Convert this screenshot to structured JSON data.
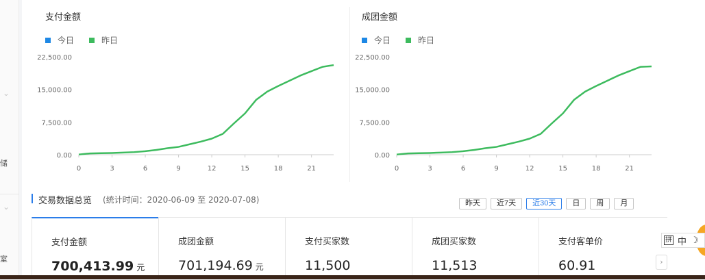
{
  "sidebar": {
    "chars": [
      "储",
      "室"
    ]
  },
  "charts": [
    {
      "title": "支付金额",
      "legend": [
        {
          "label": "今日",
          "color": "#1e88e5"
        },
        {
          "label": "昨日",
          "color": "#3dbb5e"
        }
      ],
      "y_ticks": [
        "22,500.00",
        "15,000.00",
        "7,500.00",
        "0.00"
      ],
      "x_ticks": [
        "0",
        "3",
        "6",
        "9",
        "12",
        "15",
        "18",
        "21"
      ]
    },
    {
      "title": "成团金额",
      "legend": [
        {
          "label": "今日",
          "color": "#1e88e5"
        },
        {
          "label": "昨日",
          "color": "#3dbb5e"
        }
      ],
      "y_ticks": [
        "22,500.00",
        "15,000.00",
        "7,500.00",
        "0.00"
      ],
      "x_ticks": [
        "0",
        "3",
        "6",
        "9",
        "12",
        "15",
        "18",
        "21"
      ]
    }
  ],
  "chart_data": [
    {
      "type": "line",
      "title": "支付金额",
      "x": [
        0,
        1,
        2,
        3,
        4,
        5,
        6,
        7,
        8,
        9,
        10,
        11,
        12,
        13,
        14,
        15,
        16,
        17,
        18,
        19,
        20,
        21,
        22,
        23
      ],
      "ylim": [
        0,
        22500
      ],
      "series": [
        {
          "name": "昨日",
          "color": "#3dbb5e",
          "values": [
            50,
            300,
            350,
            400,
            500,
            600,
            800,
            1100,
            1500,
            1800,
            2400,
            3000,
            3700,
            4800,
            7200,
            9500,
            12600,
            14500,
            15800,
            17000,
            18200,
            19200,
            20200,
            20600
          ]
        }
      ]
    },
    {
      "type": "line",
      "title": "成团金额",
      "x": [
        0,
        1,
        2,
        3,
        4,
        5,
        6,
        7,
        8,
        9,
        10,
        11,
        12,
        13,
        14,
        15,
        16,
        17,
        18,
        19,
        20,
        21,
        22,
        23
      ],
      "ylim": [
        0,
        22500
      ],
      "series": [
        {
          "name": "昨日",
          "color": "#3dbb5e",
          "values": [
            50,
            300,
            350,
            400,
            500,
            600,
            800,
            1100,
            1500,
            1800,
            2400,
            3000,
            3700,
            4800,
            7200,
            9500,
            12600,
            14500,
            15800,
            17000,
            18200,
            19200,
            20200,
            20300
          ]
        }
      ]
    }
  ],
  "summary": {
    "title": "交易数据总览",
    "range": "(统计时间：2020-06-09 至 2020-07-08)",
    "buttons": [
      "昨天",
      "近7天",
      "近30天",
      "日",
      "周",
      "月"
    ],
    "active_button": "近30天"
  },
  "metrics": [
    {
      "label": "支付金额",
      "value": "700,413.99",
      "unit": "元"
    },
    {
      "label": "成团金额",
      "value": "701,194.69",
      "unit": "元"
    },
    {
      "label": "支付买家数",
      "value": "11,500",
      "unit": ""
    },
    {
      "label": "成团买家数",
      "value": "11,513",
      "unit": ""
    },
    {
      "label": "支付客单价",
      "value": "60.91",
      "unit": ""
    }
  ],
  "next_arrow": "›",
  "ime": {
    "pin": "拼",
    "mode": "中",
    "moon": "☽"
  }
}
